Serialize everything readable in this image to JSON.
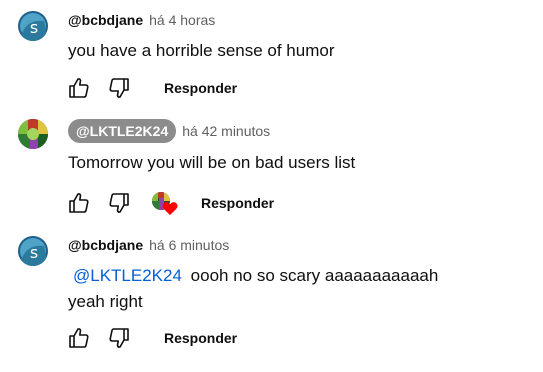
{
  "colors": {
    "link": "#065fd4",
    "secondary_text": "#606060",
    "author_chip_bg": "#8c8c8c",
    "heart": "#ff0000"
  },
  "icons": {
    "like": "thumbs-up-outline",
    "dislike": "thumbs-down-outline",
    "creator_heart": "heart"
  },
  "comments": [
    {
      "author": "@bcbdjane",
      "time": "há 4 horas",
      "text": "you have a horrible sense of humor",
      "reply_label": "Responder"
    },
    {
      "author": "@LKTLE2K24",
      "time": "há 42 minutos",
      "text": "Tomorrow you will be on bad users list",
      "reply_label": "Responder"
    },
    {
      "author": "@bcbdjane",
      "time": "há 6 minutos",
      "mention": "@LKTLE2K24",
      "text_line1": "oooh no so scary aaaaaaaaaaah",
      "text_line2": "yeah right",
      "reply_label": "Responder"
    }
  ]
}
